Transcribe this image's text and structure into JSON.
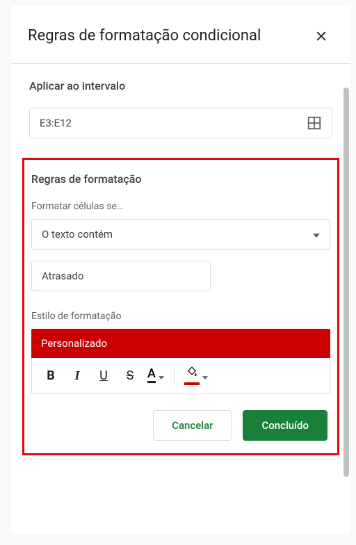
{
  "header": {
    "title": "Regras de formatação condicional"
  },
  "range": {
    "label": "Aplicar ao intervalo",
    "value": "E3:E12"
  },
  "rules": {
    "title": "Regras de formatação",
    "format_if_label": "Formatar células se…",
    "condition_selected": "O texto contém",
    "value": "Atrasado",
    "style_label": "Estilo de formatação",
    "style_chip": "Personalizado"
  },
  "toolbar": {
    "bold": "B",
    "italic": "I",
    "underline": "U",
    "strike": "S",
    "textcolor": "A"
  },
  "buttons": {
    "cancel": "Cancelar",
    "done": "Concluído"
  }
}
